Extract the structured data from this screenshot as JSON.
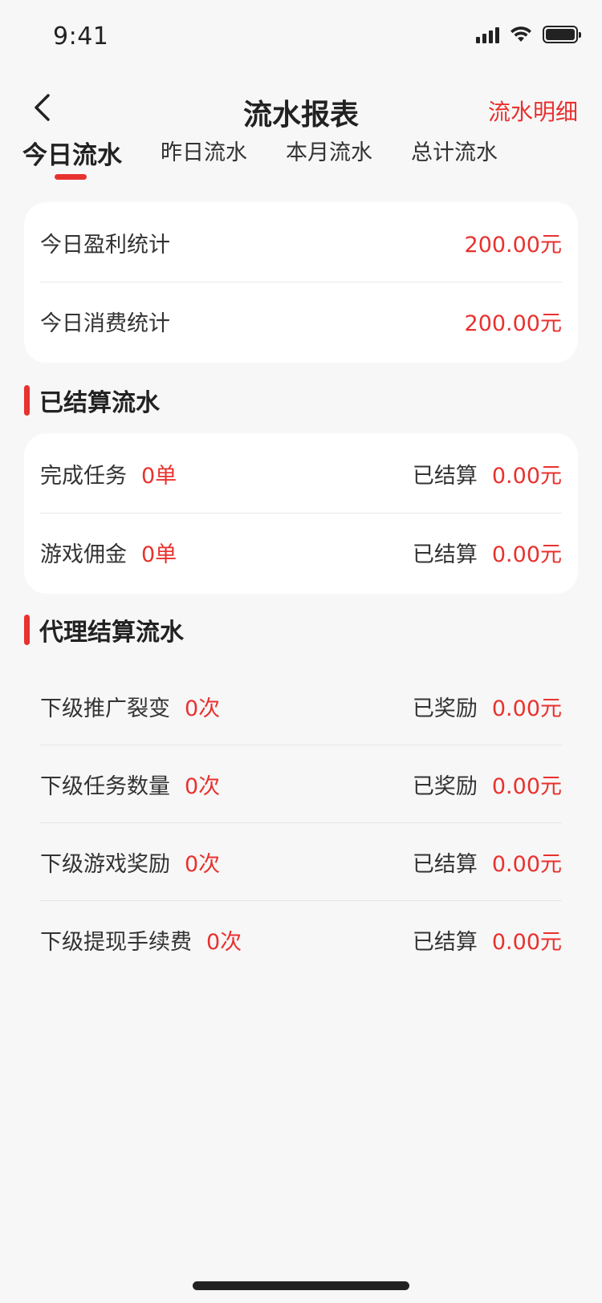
{
  "status_bar": {
    "time": "9:41"
  },
  "nav": {
    "title": "流水报表",
    "right_link": "流水明细"
  },
  "tabs": [
    {
      "label": "今日流水",
      "active": true
    },
    {
      "label": "昨日流水",
      "active": false
    },
    {
      "label": "本月流水",
      "active": false
    },
    {
      "label": "总计流水",
      "active": false
    }
  ],
  "summary": [
    {
      "label": "今日盈利统计",
      "value": "200.00元"
    },
    {
      "label": "今日消费统计",
      "value": "200.00元"
    }
  ],
  "settled_section": {
    "title": "已结算流水",
    "rows": [
      {
        "label": "完成任务",
        "count": "0单",
        "status": "已结算",
        "amount": "0.00元"
      },
      {
        "label": "游戏佣金",
        "count": "0单",
        "status": "已结算",
        "amount": "0.00元"
      }
    ]
  },
  "agent_section": {
    "title": "代理结算流水",
    "rows": [
      {
        "label": "下级推广裂变",
        "count": "0次",
        "status": "已奖励",
        "amount": "0.00元"
      },
      {
        "label": "下级任务数量",
        "count": "0次",
        "status": "已奖励",
        "amount": "0.00元"
      },
      {
        "label": "下级游戏奖励",
        "count": "0次",
        "status": "已结算",
        "amount": "0.00元"
      },
      {
        "label": "下级提现手续费",
        "count": "0次",
        "status": "已结算",
        "amount": "0.00元"
      }
    ]
  },
  "colors": {
    "accent": "#e8322f",
    "background": "#f7f7f7",
    "card": "#ffffff",
    "text": "#333333"
  }
}
